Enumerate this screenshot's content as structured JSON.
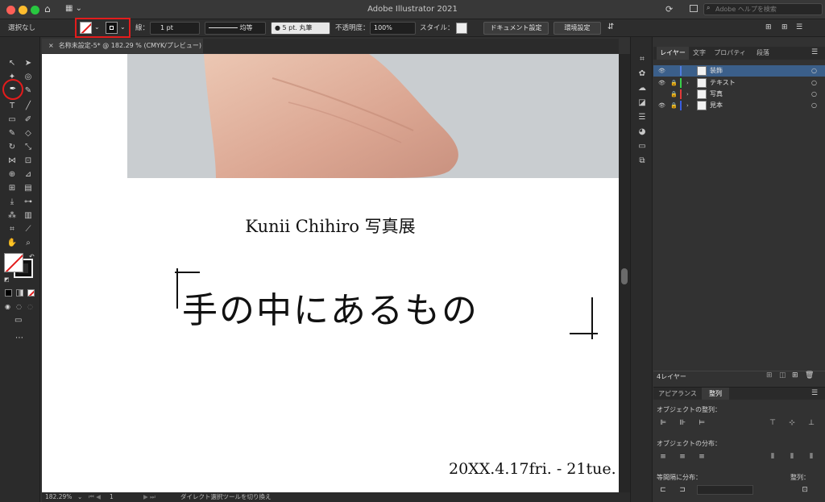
{
  "app": {
    "title": "Adobe Illustrator 2021",
    "help_search_placeholder": "Adobe ヘルプを検索"
  },
  "control": {
    "selection": "選択なし",
    "stroke_label": "線：",
    "stroke_weight": "1 pt",
    "profile": "均等",
    "brush": "5 pt. 丸筆",
    "opacity_label": "不透明度：",
    "opacity": "100%",
    "style_label": "スタイル：",
    "doc_settings": "ドキュメント設定",
    "preferences": "環境設定"
  },
  "document": {
    "tab": "名称未設定-5* @ 182.29 % (CMYK/プレビュー)",
    "subtitle": "Kunii Chihiro 写真展",
    "headline": "手の中にあるもの",
    "dates": "20XX.4.17fri. - 21tue."
  },
  "status": {
    "zoom": "182.29%",
    "page": "1",
    "tool_hint": "ダイレクト選択ツールを切り換え"
  },
  "layers_panel": {
    "tabs": [
      "レイヤー",
      "文字",
      "プロパティ",
      "段落"
    ],
    "layers": [
      {
        "name": "装飾",
        "color": "#4f7de0"
      },
      {
        "name": "テキスト",
        "color": "#39d04a"
      },
      {
        "name": "写真",
        "color": "#e03a3a"
      },
      {
        "name": "見本",
        "color": "#3a5ee0"
      }
    ],
    "count": "4レイヤー"
  },
  "align_panel": {
    "tabs": [
      "アピアランス",
      "整列"
    ],
    "align_objects": "オブジェクトの整列：",
    "distribute_objects": "オブジェクトの分布：",
    "distribute_spacing": "等間隔に分布：",
    "align_to": "整列："
  },
  "colors": {
    "highlight": "#e31c1c",
    "accent": "#3b5f8a"
  }
}
